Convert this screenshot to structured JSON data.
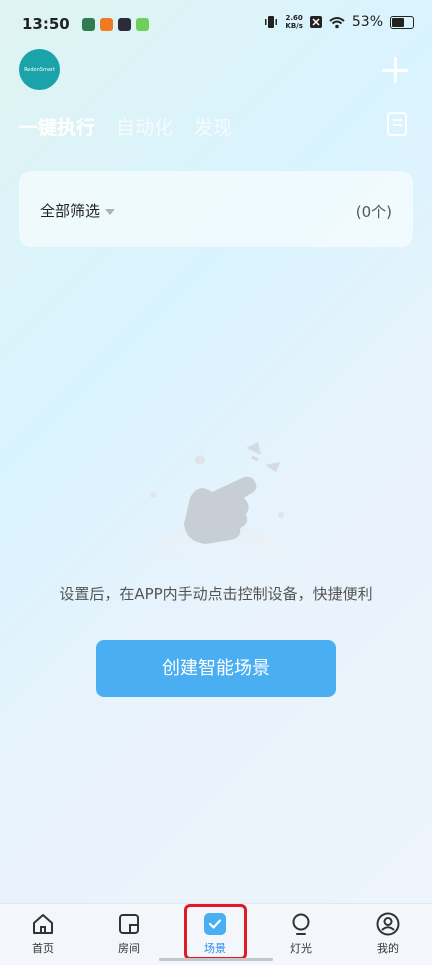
{
  "status_bar": {
    "time": "13:50",
    "network_speed_value": "2.60",
    "network_speed_unit": "KB/s",
    "battery_percent": "53%",
    "battery_level": 0.53
  },
  "header": {
    "logo_text": "RedonSmart",
    "tabs": [
      {
        "label": "一键执行",
        "active": true
      },
      {
        "label": "自动化",
        "active": false
      },
      {
        "label": "发现",
        "active": false
      }
    ]
  },
  "filter": {
    "label": "全部筛选",
    "count": "(0个)"
  },
  "empty_state": {
    "message": "设置后，在APP内手动点击控制设备，快捷便利",
    "button_label": "创建智能场景"
  },
  "bottom_nav": {
    "items": [
      {
        "label": "首页",
        "icon": "home-icon"
      },
      {
        "label": "房间",
        "icon": "room-icon"
      },
      {
        "label": "场景",
        "icon": "scene-check-icon",
        "active": true
      },
      {
        "label": "灯光",
        "icon": "bulb-icon"
      },
      {
        "label": "我的",
        "icon": "profile-icon"
      }
    ]
  },
  "colors": {
    "accent": "#4aaef2",
    "active_nav": "#2f8ef0",
    "highlight_box": "#e01b24",
    "logo_bg": "#1aa3a9"
  }
}
